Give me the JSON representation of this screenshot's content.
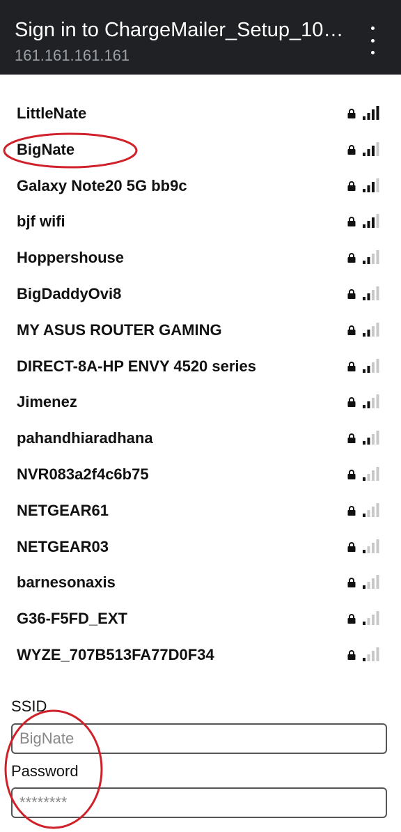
{
  "header": {
    "title": "Sign in to ChargeMailer_Setup_10…",
    "subtitle": "161.161.161.161"
  },
  "networks": [
    {
      "name": "LittleNate",
      "secured": true,
      "signal": 4
    },
    {
      "name": "BigNate",
      "secured": true,
      "signal": 3
    },
    {
      "name": "Galaxy Note20 5G bb9c",
      "secured": true,
      "signal": 3
    },
    {
      "name": "bjf wifi",
      "secured": true,
      "signal": 3
    },
    {
      "name": "Hoppershouse",
      "secured": true,
      "signal": 2
    },
    {
      "name": "BigDaddyOvi8",
      "secured": true,
      "signal": 2
    },
    {
      "name": "MY ASUS ROUTER GAMING",
      "secured": true,
      "signal": 2
    },
    {
      "name": "DIRECT-8A-HP ENVY 4520 series",
      "secured": true,
      "signal": 2
    },
    {
      "name": "Jimenez",
      "secured": true,
      "signal": 2
    },
    {
      "name": "pahandhiaradhana",
      "secured": true,
      "signal": 2
    },
    {
      "name": "NVR083a2f4c6b75",
      "secured": true,
      "signal": 1
    },
    {
      "name": "NETGEAR61",
      "secured": true,
      "signal": 1
    },
    {
      "name": "NETGEAR03",
      "secured": true,
      "signal": 1
    },
    {
      "name": "barnesonaxis",
      "secured": true,
      "signal": 1
    },
    {
      "name": "G36-F5FD_EXT",
      "secured": true,
      "signal": 1
    },
    {
      "name": "WYZE_707B513FA77D0F34",
      "secured": true,
      "signal": 1
    }
  ],
  "form": {
    "ssid_label": "SSID",
    "ssid_value": "BigNate",
    "password_label": "Password",
    "password_value": "********"
  },
  "colors": {
    "header_bg": "#202124",
    "annotation": "#d0202a",
    "signal_on": "#111111",
    "signal_off": "#c8c8c8"
  },
  "icons": {
    "menu": "more-vert-icon",
    "lock": "lock-icon",
    "signal": "wifi-signal-icon"
  }
}
